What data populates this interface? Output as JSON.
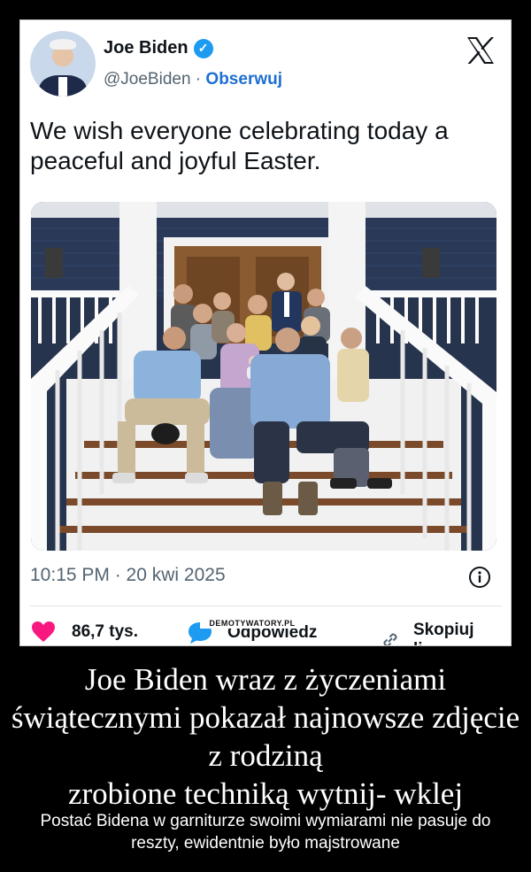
{
  "post": {
    "author_name": "Joe Biden",
    "handle": "@JoeBiden",
    "separator": " · ",
    "follow_label": "Obserwuj",
    "text": "We wish everyone celebrating today a peaceful and joyful Easter.",
    "timestamp": "10:15 PM · 20 kwi 2025",
    "likes_count": "86,7 tys.",
    "reply_label": "Odpowiedz",
    "copy_label": "Skopiuj li..."
  },
  "icons": {
    "verified": "verified-badge-icon",
    "platform": "x-logo-icon",
    "info": "info-icon",
    "like": "heart-icon",
    "reply": "speech-bubble-icon",
    "copy": "link-icon"
  },
  "colors": {
    "like": "#f91880",
    "reply": "#1d9bf0",
    "verified": "#1d9bf0",
    "follow": "#1d6fd1",
    "secondary_text": "#536471"
  },
  "watermark": "DEMOTYWATORY.PL",
  "caption": {
    "headline_lines": [
      "Joe Biden wraz z życzeniami",
      "świątecznymi pokazał najnowsze zdjęcie",
      "z rodziną",
      "zrobione techniką wytnij- wklej"
    ],
    "subtext": "Postać Bidena w garniturze swoimi wymiarami nie pasuje do reszty, ewidentnie było majstrowane"
  }
}
